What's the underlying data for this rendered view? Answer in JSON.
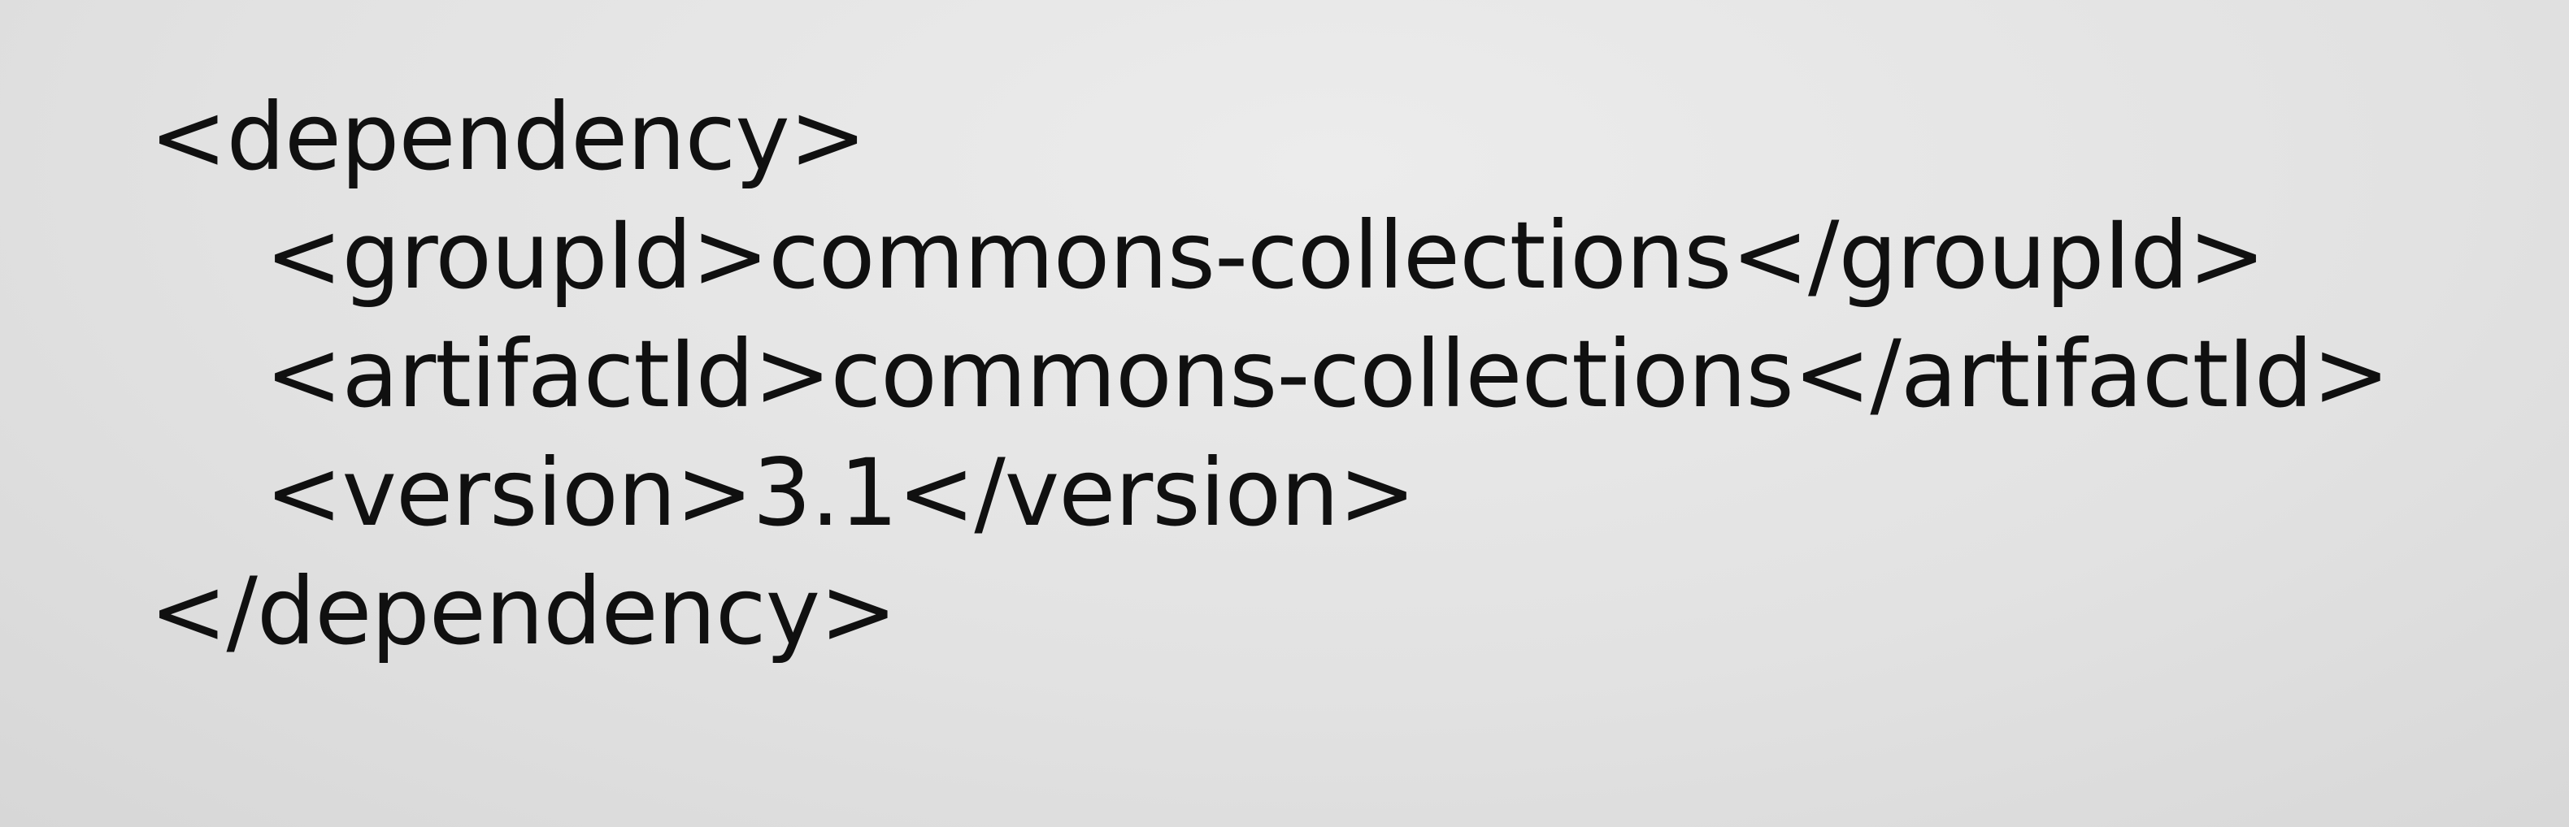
{
  "code": {
    "lines": [
      "<dependency>",
      "<groupId>commons-collections</groupId>",
      "<artifactId>commons-collections</artifactId>",
      "<version>3.1</version>",
      "</dependency>"
    ]
  }
}
